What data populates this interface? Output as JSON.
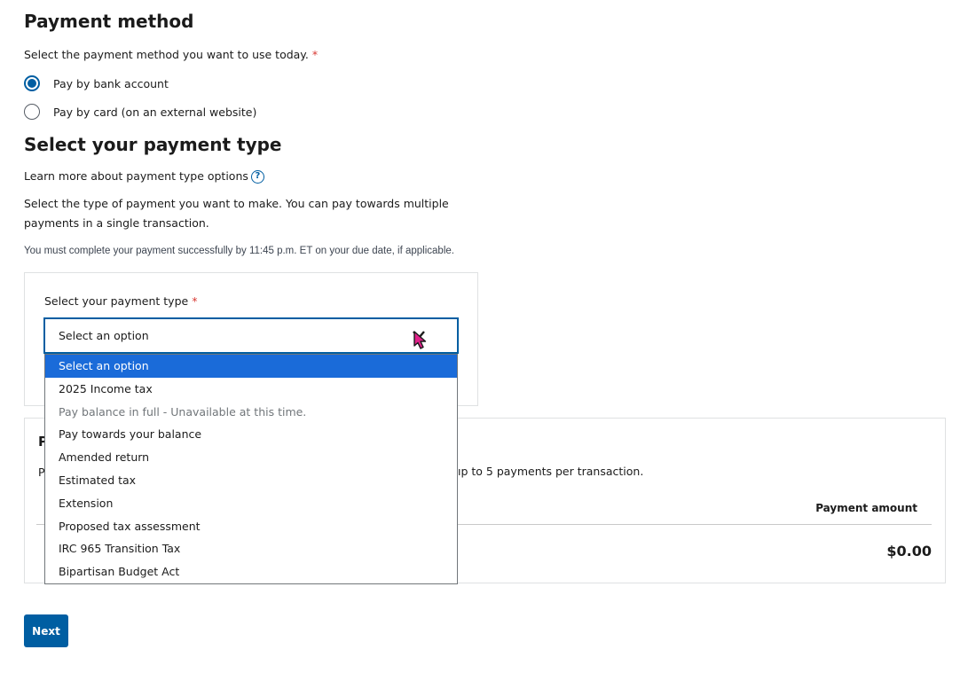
{
  "payment_method": {
    "title": "Payment method",
    "instruction": "Select the payment method you want to use today.",
    "required_mark": "*",
    "options": [
      {
        "label": "Pay by bank account",
        "checked": true
      },
      {
        "label": "Pay by card (on an external website)",
        "checked": false
      }
    ]
  },
  "payment_type": {
    "title": "Select your payment type",
    "learn_more": "Learn more about payment type options",
    "help_icon": "question-circle-icon",
    "description_line1": "Select the type of payment you want to make. You can pay towards multiple",
    "description_line2": "payments in a single transaction.",
    "deadline_note": "You must complete your payment successfully by 11:45 p.m. ET on your due date, if applicable.",
    "select_label": "Select your payment type",
    "required_mark": "*",
    "select_value": "Select an option",
    "dropdown_options": [
      {
        "label": "Select an option",
        "selected": true,
        "disabled": false
      },
      {
        "label": "2025 Income tax",
        "selected": false,
        "disabled": false
      },
      {
        "label": "Pay balance in full - Unavailable at this time.",
        "selected": false,
        "disabled": true
      },
      {
        "label": "Pay towards your balance",
        "selected": false,
        "disabled": false
      },
      {
        "label": "Amended return",
        "selected": false,
        "disabled": false
      },
      {
        "label": "Estimated tax",
        "selected": false,
        "disabled": false
      },
      {
        "label": "Extension",
        "selected": false,
        "disabled": false
      },
      {
        "label": "Proposed tax assessment",
        "selected": false,
        "disabled": false
      },
      {
        "label": "IRC 965 Transition Tax",
        "selected": false,
        "disabled": false
      },
      {
        "label": "Bipartisan Budget Act",
        "selected": false,
        "disabled": false
      }
    ]
  },
  "summary": {
    "heading_fragment": "P",
    "text_fragment": "P",
    "limit_note_fragment": "ıp to 5 payments per transaction.",
    "column_header": "Payment amount",
    "amount": "$0.00"
  },
  "actions": {
    "next_label": "Next"
  },
  "colors": {
    "primary": "#005ea2",
    "selected_option": "#1a6bd9",
    "required": "#d83933",
    "cursor": "#e0218a"
  }
}
